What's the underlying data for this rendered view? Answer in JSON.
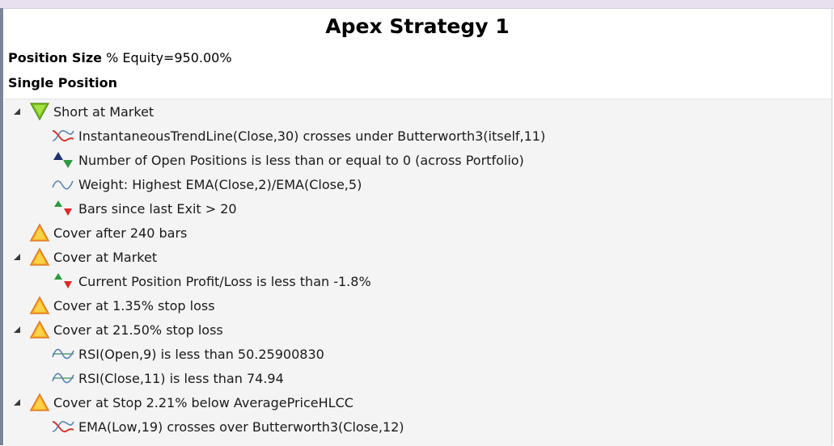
{
  "title": "Apex Strategy 1",
  "position_size": {
    "label": "Position Size",
    "value": "% Equity=950.00%"
  },
  "position_mode": "Single Position",
  "tree": [
    {
      "level": 0,
      "expandable": true,
      "icon": "green-down-triangle-icon",
      "text": "Short at Market"
    },
    {
      "level": 1,
      "expandable": false,
      "icon": "indicator-cross-icon",
      "text": "InstantaneousTrendLine(Close,30) crosses under Butterworth3(itself,11)"
    },
    {
      "level": 1,
      "expandable": false,
      "icon": "open-positions-icon",
      "text": "Number of Open Positions is less than or equal to 0 (across Portfolio)"
    },
    {
      "level": 1,
      "expandable": false,
      "icon": "weight-wave-icon",
      "text": "Weight: Highest EMA(Close,2)/EMA(Close,5)"
    },
    {
      "level": 1,
      "expandable": false,
      "icon": "up-down-arrows-icon",
      "text": "Bars since last Exit > 20"
    },
    {
      "level": 0,
      "expandable": false,
      "icon": "orange-up-triangle-icon",
      "text": "Cover after 240 bars"
    },
    {
      "level": 0,
      "expandable": true,
      "icon": "orange-up-triangle-icon",
      "text": "Cover at Market"
    },
    {
      "level": 1,
      "expandable": false,
      "icon": "up-down-arrows-icon",
      "text": "Current Position Profit/Loss is less than -1.8%"
    },
    {
      "level": 0,
      "expandable": false,
      "icon": "orange-up-triangle-icon",
      "text": "Cover at 1.35% stop loss"
    },
    {
      "level": 0,
      "expandable": true,
      "icon": "orange-up-triangle-icon",
      "text": "Cover at 21.50% stop loss"
    },
    {
      "level": 1,
      "expandable": false,
      "icon": "oscillator-icon",
      "text": "RSI(Open,9) is less than 50.25900830"
    },
    {
      "level": 1,
      "expandable": false,
      "icon": "oscillator-icon",
      "text": "RSI(Close,11) is less than 74.94"
    },
    {
      "level": 0,
      "expandable": true,
      "icon": "orange-up-triangle-icon",
      "text": "Cover at Stop 2.21% below AveragePriceHLCC"
    },
    {
      "level": 1,
      "expandable": false,
      "icon": "indicator-cross-icon",
      "text": "EMA(Low,19) crosses over Butterworth3(Close,12)"
    }
  ],
  "colors": {
    "short_green": "#7cc61f",
    "cover_orange": "#f7b71e",
    "cross_red": "#d6362b",
    "wave_blue": "#5a82b8",
    "arrow_green": "#2d9a3f",
    "arrow_red": "#e02626",
    "navy": "#23306e"
  }
}
